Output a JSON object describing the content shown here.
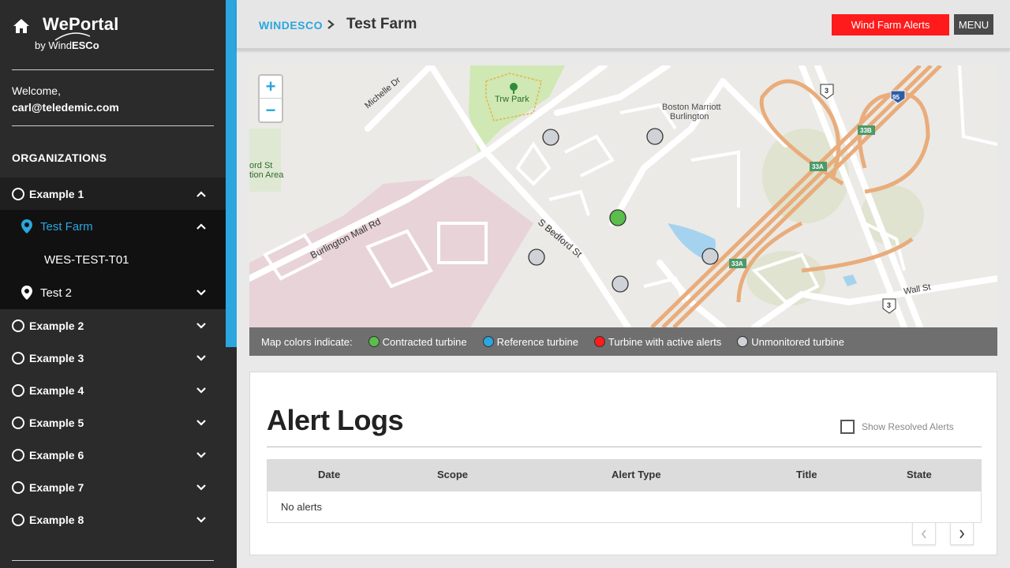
{
  "sidebar": {
    "brand_title": "WePortal",
    "brand_by": "by Wind",
    "brand_company": "ESCo",
    "welcome_label": "Welcome,",
    "user_email": "carl@teledemic.com",
    "organizations_heading": "ORGANIZATIONS",
    "orgs": [
      {
        "label": "Example 1",
        "expanded": true
      },
      {
        "label": "Example 2",
        "expanded": false
      },
      {
        "label": "Example 3",
        "expanded": false
      },
      {
        "label": "Example 4",
        "expanded": false
      },
      {
        "label": "Example 5",
        "expanded": false
      },
      {
        "label": "Example 6",
        "expanded": false
      },
      {
        "label": "Example 7",
        "expanded": false
      },
      {
        "label": "Example 8",
        "expanded": false
      }
    ],
    "farms": [
      {
        "label": "Test Farm",
        "selected": true,
        "expanded": true
      },
      {
        "label": "Test 2",
        "selected": false,
        "expanded": false
      }
    ],
    "turbine": "WES-TEST-T01"
  },
  "header": {
    "breadcrumb_root": "WINDESCO",
    "breadcrumb_current": "Test Farm",
    "alerts_button": "Wind Farm Alerts",
    "menu_button": "MENU"
  },
  "map": {
    "zoom_in": "+",
    "zoom_out": "−",
    "labels": {
      "park": "Trw Park",
      "hotel_1": "Boston Marriott",
      "hotel_2": "Burlington",
      "road_burlington_mall": "Burlington Mall Rd",
      "road_s_bedford": "S Bedford St",
      "road_michelle": "Michelle Dr",
      "road_wall": "Wall St",
      "area_1": "ord St",
      "area_2": "tion Area",
      "shield_3a": "3",
      "shield_3b": "3",
      "shield_95": "95",
      "exit_33b": "33B",
      "exit_33a_1": "33A",
      "exit_33a_2": "33A"
    }
  },
  "legend": {
    "title": "Map colors indicate:",
    "items": [
      {
        "label": "Contracted turbine",
        "color": "#5bbd4a"
      },
      {
        "label": "Reference turbine",
        "color": "#2ba6de"
      },
      {
        "label": "Turbine with active alerts",
        "color": "#ff1b1b"
      },
      {
        "label": "Unmonitored turbine",
        "color": "#cfd2d6"
      }
    ]
  },
  "alerts": {
    "title": "Alert Logs",
    "show_resolved_label": "Show Resolved Alerts",
    "columns": [
      "Date",
      "Scope",
      "Alert Type",
      "Title",
      "State"
    ],
    "empty_message": "No alerts"
  },
  "colors": {
    "accent": "#2ba6de",
    "alert": "#ff1b1b",
    "sidebar": "#2b2b2b"
  }
}
